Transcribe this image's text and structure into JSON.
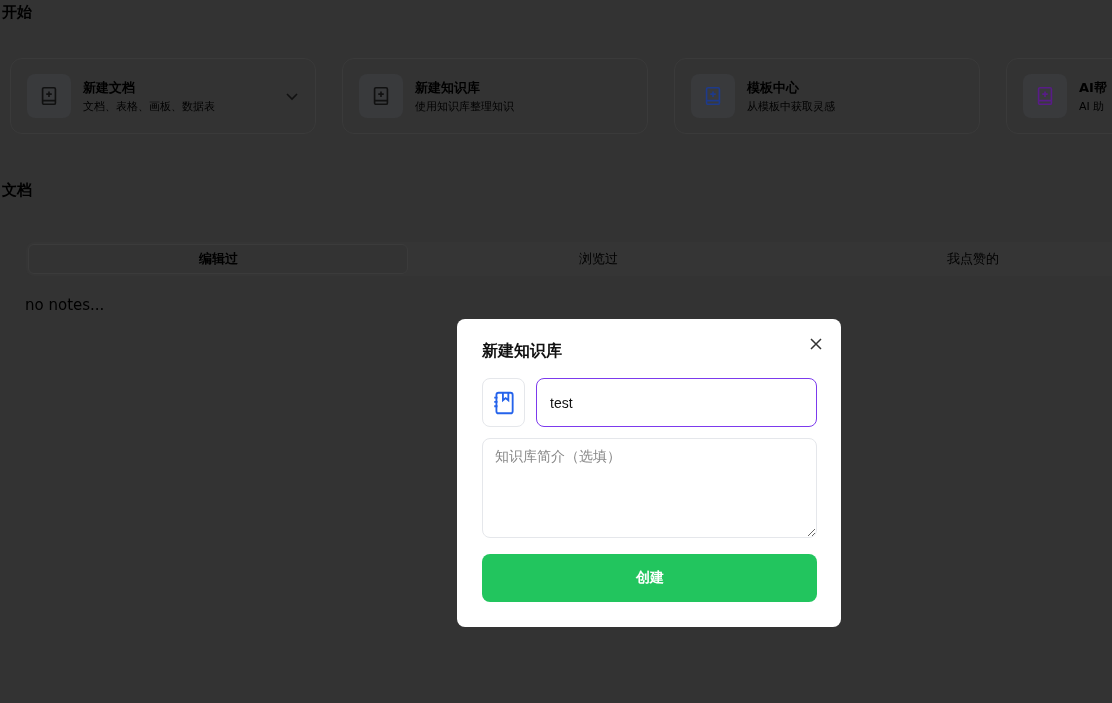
{
  "start": {
    "title": "开始",
    "cards": [
      {
        "title": "新建文档",
        "subtitle": "文档、表格、画板、数据表",
        "color": "#111111",
        "dropdown": true
      },
      {
        "title": "新建知识库",
        "subtitle": "使用知识库整理知识",
        "color": "#111111",
        "dropdown": false
      },
      {
        "title": "模板中心",
        "subtitle": "从模板中获取灵感",
        "color": "#1e3a8a",
        "dropdown": false
      },
      {
        "title": "AI帮",
        "subtitle": "AI 助",
        "color": "#581c87",
        "dropdown": false
      }
    ]
  },
  "docs": {
    "title": "文档",
    "tabs": [
      {
        "label": "编辑过",
        "selected": true
      },
      {
        "label": "浏览过",
        "selected": false
      },
      {
        "label": "我点赞的",
        "selected": false
      }
    ],
    "empty": "no notes..."
  },
  "dialog": {
    "title": "新建知识库",
    "name_value": "test",
    "description_placeholder": "知识库简介（选填）",
    "submit": "创建"
  }
}
